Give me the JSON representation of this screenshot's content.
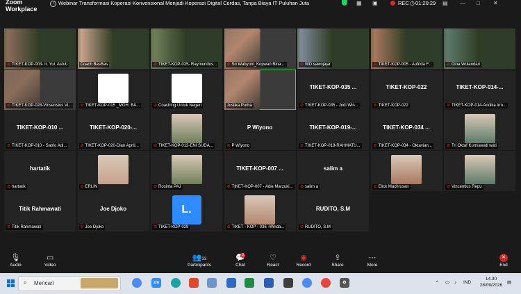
{
  "app": {
    "title_line1": "Zoom",
    "title_line2": "Workplace"
  },
  "meeting": {
    "title": "Webinar Transformasi Koperasi Konvensional Menjadi Koperasi Digital Cerdas, Tanpa Biaya IT Puluhan Juta"
  },
  "recording": {
    "label": "REC"
  },
  "timer": {
    "value": "01:20:29"
  },
  "tiles": [
    {
      "big": "",
      "label": "TIKET-KOP-003- Ir. Yul. Astuti",
      "muted": true,
      "type": "green"
    },
    {
      "big": "",
      "label": "Coach BasBas",
      "muted": false,
      "type": "green"
    },
    {
      "big": "",
      "label": "TIKET-KOP-025- Raymundus...",
      "muted": true,
      "type": "green"
    },
    {
      "big": "",
      "label": "Sri Wahyuni_Kopwan Bina ...",
      "muted": true,
      "type": "video"
    },
    {
      "big": "",
      "label": "WD sawojajar",
      "muted": true,
      "type": "green"
    },
    {
      "big": "",
      "label": "TIKET-KOP-005 - Aufrida F...",
      "muted": true,
      "type": "green"
    },
    {
      "big": "",
      "label": "Dina Wulandari",
      "muted": true,
      "type": "green"
    },
    {
      "big": "",
      "label": "TIKET-KOP-028-Vinsensius Vi...",
      "muted": true,
      "type": "video"
    },
    {
      "big": "",
      "label": "TIKET-KOP-015 _MOH. BA...",
      "muted": true,
      "type": "logo"
    },
    {
      "big": "",
      "label": "Coaching Untuk Negeri",
      "muted": true,
      "type": "logo"
    },
    {
      "big": "",
      "label": "Justika Purba",
      "muted": false,
      "type": "video",
      "active": true
    },
    {
      "big": "TIKET-KOP-035 ...",
      "label": "TIKET-KOP-035 - Jodi Win...",
      "muted": true,
      "type": "name"
    },
    {
      "big": "TIKET-KOP-022",
      "label": "TIKET-KOP-022",
      "muted": true,
      "type": "name"
    },
    {
      "big": "TIKET-KOP-014-...",
      "label": "TIKET-KOP-014-Andika Irm...",
      "muted": true,
      "type": "name"
    },
    {
      "big": "TIKET-KOP-010 ...",
      "label": "TIKET-KOP-010 - Satrio Adi...",
      "muted": true,
      "type": "name"
    },
    {
      "big": "TIKET-KOP-020-...",
      "label": "TIKET-KOP-020-Dian Aprili...",
      "muted": true,
      "type": "name"
    },
    {
      "big": "",
      "label": "TIKET-KOP-012-ENI SUDA...",
      "muted": true,
      "type": "photo"
    },
    {
      "big": "P Wiyono",
      "label": "P Wiyono",
      "muted": true,
      "type": "name"
    },
    {
      "big": "TIKET-KOP-019-...",
      "label": "TIKET-KOP-019-RAHMATU...",
      "muted": true,
      "type": "name"
    },
    {
      "big": "TIKET-KOP-034 ...",
      "label": "TIKET-KOP-034 - Oktavian...",
      "muted": true,
      "type": "name"
    },
    {
      "big": "",
      "label": "Tri Oktaf Kurniawati wati",
      "muted": true,
      "type": "photo"
    },
    {
      "big": "hartatik",
      "label": "hartatik",
      "muted": true,
      "type": "name"
    },
    {
      "big": "",
      "label": "ERLIN",
      "muted": true,
      "type": "photo"
    },
    {
      "big": "",
      "label": "Rosinta PAJ",
      "muted": true,
      "type": "photo"
    },
    {
      "big": "TIKET-KOP-007 ...",
      "label": "TIKET-KOP-007 - Adie Marzuki...",
      "muted": true,
      "type": "name"
    },
    {
      "big": "salim a",
      "label": "salim a",
      "muted": true,
      "type": "name"
    },
    {
      "big": "",
      "label": "Elick Machrusan",
      "muted": true,
      "type": "photo"
    },
    {
      "big": "",
      "label": "Vincentius Repu",
      "muted": true,
      "type": "photo"
    },
    {
      "big": "Titik Rahmawati",
      "label": "Titik Rahmawati",
      "muted": true,
      "type": "name"
    },
    {
      "big": "Joe Djoko",
      "label": "Joe Djoko",
      "muted": true,
      "type": "name"
    },
    {
      "big": "",
      "label": "TIKET-KOP-029",
      "muted": true,
      "type": "letter",
      "letter": "L."
    },
    {
      "big": "",
      "label": "TIKET - KOP - 036 -Winda...",
      "muted": true,
      "type": "photo"
    },
    {
      "big": "RUDITO, S.M",
      "label": "RUDITO, S.M",
      "muted": true,
      "type": "name"
    }
  ],
  "controls": {
    "audio": "Audio",
    "video": "Video",
    "participants": "Participants",
    "participants_count": "33",
    "chat": "Chat",
    "chat_badge": "3",
    "react": "React",
    "record": "Record",
    "share": "Share",
    "more": "More",
    "end": "End"
  },
  "taskbar": {
    "search_placeholder": "Mencari",
    "lang": "IND",
    "time": "14.30",
    "date": "28/09/2026"
  },
  "colors": {
    "active_border": "#3ed153",
    "muted_mic": "#e03030",
    "end": "#c92a2a"
  }
}
